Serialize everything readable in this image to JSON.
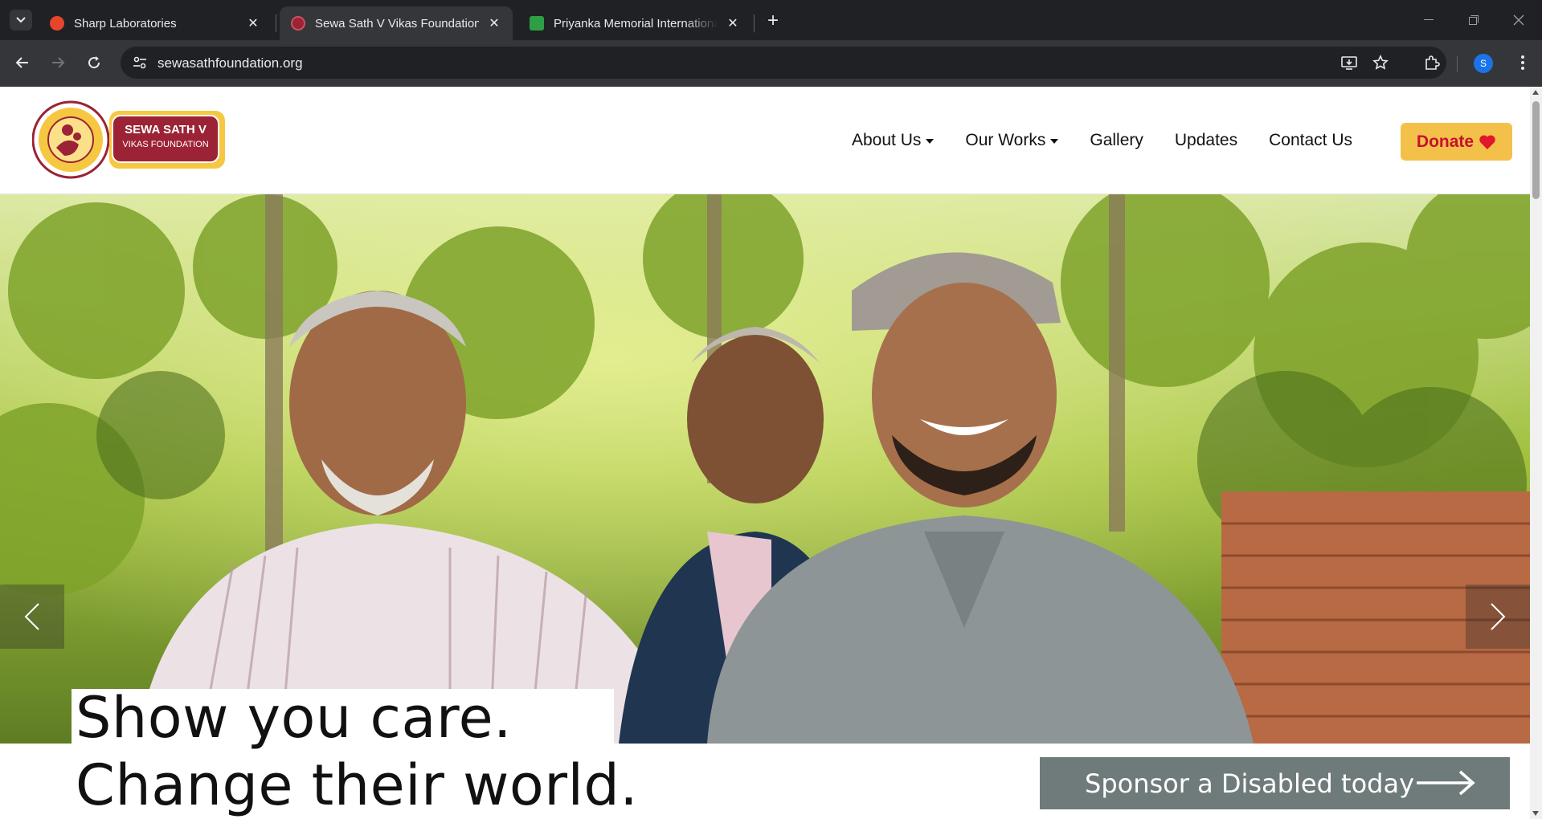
{
  "browser": {
    "tabs": [
      {
        "title": "Sharp Laboratories",
        "favicon": "sharp-favicon",
        "color": "#e8452c"
      },
      {
        "title": "Sewa Sath V Vikas Foundation",
        "favicon": "sewa-favicon",
        "color": "#9b2335",
        "active": true
      },
      {
        "title": "Priyanka Memorial International",
        "favicon": "priyanka-favicon",
        "color": "#2e9e44"
      }
    ],
    "url": "sewasathfoundation.org",
    "profile_initial": "S"
  },
  "site": {
    "logo": {
      "line1": "SEWA SATH V",
      "line2": "VIKAS FOUNDATION"
    },
    "nav": {
      "about": "About Us",
      "works": "Our Works",
      "gallery": "Gallery",
      "updates": "Updates",
      "contact": "Contact Us",
      "donate": "Donate"
    },
    "hero": {
      "headline_line1": "Show you care.",
      "headline_line2": "Change their world.",
      "sponsor_label": "Sponsor a Disabled today"
    }
  },
  "colors": {
    "donate_bg": "#f3c14a",
    "donate_text": "#c8102e",
    "brand_maroon": "#9b2335",
    "brand_yellow": "#f6c842",
    "sponsor_bg": "#6f7b7b"
  }
}
